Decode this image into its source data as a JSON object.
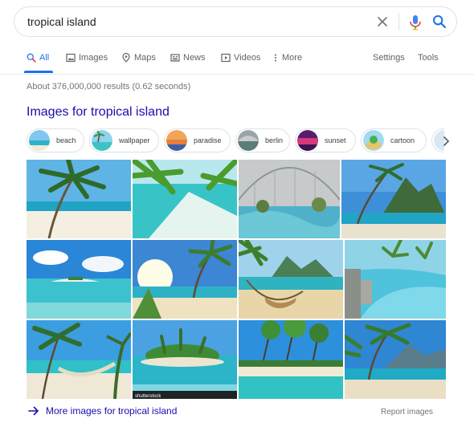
{
  "search": {
    "query": "tropical island"
  },
  "tabs": [
    {
      "label": "All",
      "icon": "search-icon",
      "active": true
    },
    {
      "label": "Images",
      "icon": "image-icon",
      "active": false
    },
    {
      "label": "Maps",
      "icon": "map-pin-icon",
      "active": false
    },
    {
      "label": "News",
      "icon": "news-icon",
      "active": false
    },
    {
      "label": "Videos",
      "icon": "play-icon",
      "active": false
    },
    {
      "label": "More",
      "icon": "more-vertical-icon",
      "active": false
    }
  ],
  "tools": {
    "settings_label": "Settings",
    "tools_label": "Tools"
  },
  "results_count": "About 376,000,000 results (0.62 seconds)",
  "images_section": {
    "heading": "Images for tropical island",
    "chips": [
      "beach",
      "wallpaper",
      "paradise",
      "berlin",
      "sunset",
      "cartoon"
    ],
    "watermark": "shutterstock",
    "more_link": "More images for tropical island",
    "report_label": "Report images"
  },
  "colors": {
    "link": "#1a0dab",
    "accent_blue": "#1a73e8",
    "muted_text": "#70757a",
    "tab_text": "#5f6368"
  }
}
